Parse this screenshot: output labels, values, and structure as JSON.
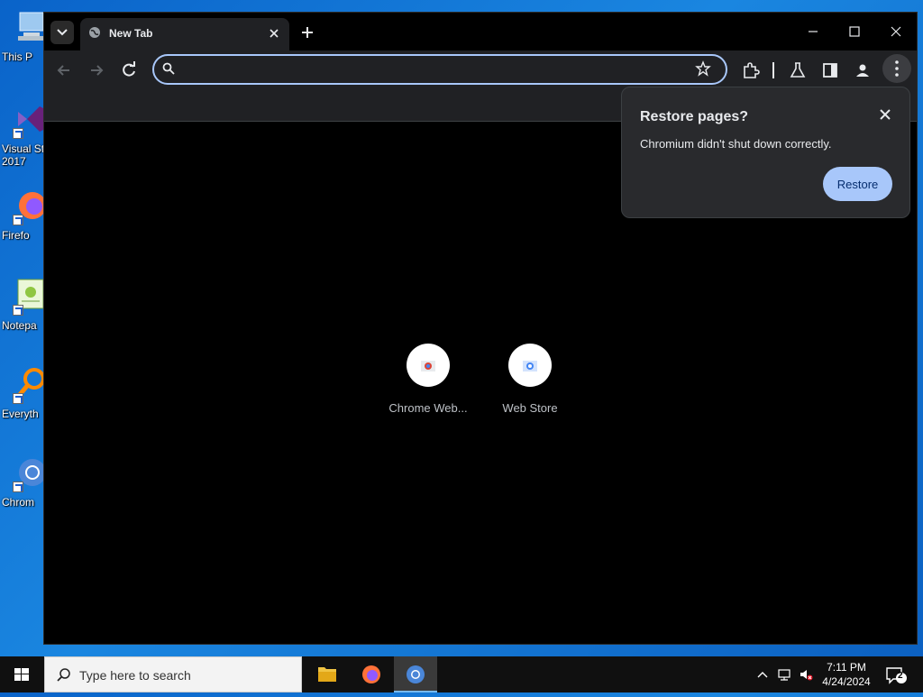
{
  "desktop": {
    "icons": [
      {
        "label": "This P"
      },
      {
        "label": "Visual St\n2017"
      },
      {
        "label": "Firefo"
      },
      {
        "label": "Notepa"
      },
      {
        "label": "Everyth"
      },
      {
        "label": "Chrom"
      }
    ]
  },
  "browser": {
    "tab": {
      "title": "New Tab"
    },
    "omnibox": {
      "value": "",
      "placeholder": ""
    },
    "shortcuts": [
      {
        "label": "Chrome Web..."
      },
      {
        "label": "Web Store"
      }
    ],
    "restore_popup": {
      "title": "Restore pages?",
      "message": "Chromium didn't shut down correctly.",
      "button": "Restore"
    },
    "colors": {
      "accent": "#a8c7fa",
      "toolbar": "#202124",
      "page": "#000000"
    }
  },
  "taskbar": {
    "search_placeholder": "Type here to search",
    "time": "7:11 PM",
    "date": "4/24/2024",
    "notification_count": "2"
  }
}
